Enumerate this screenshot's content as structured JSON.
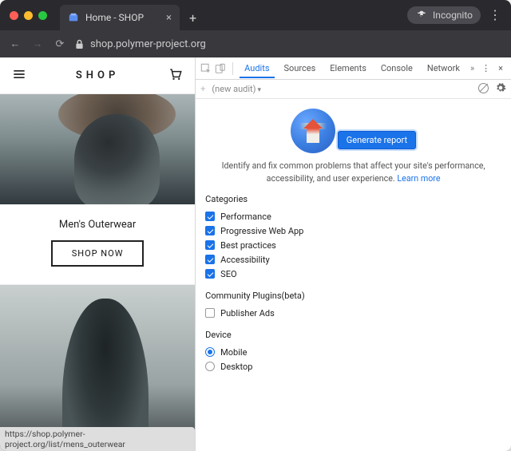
{
  "browser": {
    "tab_title": "Home - SHOP",
    "incognito_label": "Incognito",
    "url_host": "shop.polymer-project.org",
    "url_path": ""
  },
  "shop": {
    "logo": "SHOP",
    "card_title": "Men's Outerwear",
    "cta": "SHOP NOW",
    "status_url": "https://shop.polymer-project.org/list/mens_outerwear"
  },
  "devtools": {
    "tabs": [
      "Audits",
      "Sources",
      "Elements",
      "Console",
      "Network"
    ],
    "active_tab": "Audits",
    "subbar_text": "(new audit)",
    "generate_label": "Generate report",
    "description": "Identify and fix common problems that affect your site's performance, accessibility, and user experience.",
    "learn_more": "Learn more",
    "categories_heading": "Categories",
    "categories": [
      {
        "label": "Performance",
        "checked": true
      },
      {
        "label": "Progressive Web App",
        "checked": true
      },
      {
        "label": "Best practices",
        "checked": true
      },
      {
        "label": "Accessibility",
        "checked": true
      },
      {
        "label": "SEO",
        "checked": true
      }
    ],
    "plugins_heading": "Community Plugins(beta)",
    "plugins": [
      {
        "label": "Publisher Ads",
        "checked": false
      }
    ],
    "device_heading": "Device",
    "devices": [
      {
        "label": "Mobile",
        "checked": true
      },
      {
        "label": "Desktop",
        "checked": false
      }
    ]
  }
}
